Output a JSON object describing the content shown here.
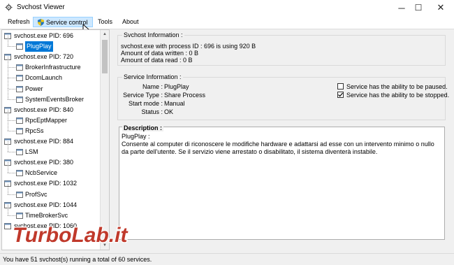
{
  "window": {
    "title": "Svchost Viewer",
    "controls": {
      "minimize": "─",
      "maximize": "☐",
      "close": "✕"
    }
  },
  "menu": {
    "refresh": "Refresh",
    "service_control": "Service control",
    "tools": "Tools",
    "about": "About"
  },
  "tree": [
    {
      "label": "svchost.exe PID: 696",
      "level": 0
    },
    {
      "label": "PlugPlay",
      "level": 1,
      "selected": true
    },
    {
      "label": "svchost.exe PID: 720",
      "level": 0
    },
    {
      "label": "BrokerInfrastructure",
      "level": 1
    },
    {
      "label": "DcomLaunch",
      "level": 1
    },
    {
      "label": "Power",
      "level": 1
    },
    {
      "label": "SystemEventsBroker",
      "level": 1
    },
    {
      "label": "svchost.exe PID: 840",
      "level": 0
    },
    {
      "label": "RpcEptMapper",
      "level": 1
    },
    {
      "label": "RpcSs",
      "level": 1
    },
    {
      "label": "svchost.exe PID: 884",
      "level": 0
    },
    {
      "label": "LSM",
      "level": 1
    },
    {
      "label": "svchost.exe PID: 380",
      "level": 0
    },
    {
      "label": "NcbService",
      "level": 1
    },
    {
      "label": "svchost.exe PID: 1032",
      "level": 0
    },
    {
      "label": "ProfSvc",
      "level": 1
    },
    {
      "label": "svchost.exe PID: 1044",
      "level": 0
    },
    {
      "label": "TimeBrokerSvc",
      "level": 1
    },
    {
      "label": "svchost.exe PID: 1060",
      "level": 0
    }
  ],
  "svchost_info": {
    "title": "Svchost Information :",
    "line1": "svchost.exe with process ID : 696 is using 920 B",
    "line2": "Amount of data written : 0 B",
    "line3": "Amount of data read : 0 B"
  },
  "service_info": {
    "title": "Service Information :",
    "name_label": "Name :",
    "name_value": "PlugPlay",
    "type_label": "Service Type :",
    "type_value": "Share Process",
    "start_label": "Start mode :",
    "start_value": "Manual",
    "status_label": "Status :",
    "status_value": "OK",
    "can_pause_label": "Service has the ability to be paused.",
    "can_pause": false,
    "can_stop_label": "Service has the ability to be stopped.",
    "can_stop": true
  },
  "description": {
    "title": "Description :",
    "heading": "PlugPlay :",
    "text": "Consente al computer di riconoscere le modifiche hardware e adattarsi ad esse con un intervento minimo o nullo da parte dell'utente. Se il servizio viene arrestato o disabilitato, il sistema diventerà instabile."
  },
  "status_bar": {
    "text": "You have 51 svchost(s) running a total of 60 services."
  },
  "watermark": {
    "text": "TurboLab.it"
  },
  "colors": {
    "selection": "#0078d7",
    "menu_highlight": "#cde8ff",
    "watermark_red": "#c0392b"
  }
}
